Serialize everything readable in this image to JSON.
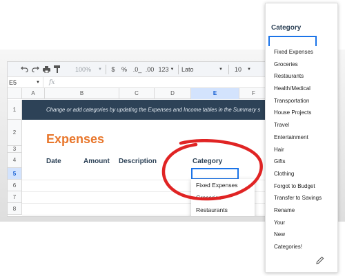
{
  "toolbar": {
    "zoom": "100%",
    "currency": "$",
    "percent": "%",
    "dec_less": ".0_",
    "dec_more": ".00",
    "number_format": "123",
    "font": "Lato",
    "font_size": "10"
  },
  "formula_bar": {
    "cell_ref": "E5",
    "fx": "fx"
  },
  "columns": [
    "A",
    "B",
    "C",
    "D",
    "E",
    "F"
  ],
  "rows": [
    "1",
    "2",
    "3",
    "4",
    "5",
    "6",
    "7",
    "8"
  ],
  "sheet": {
    "banner": "Change or add categories by updating the Expenses and Income tables in the Summary s",
    "title": "Expenses",
    "headers": {
      "date": "Date",
      "amount": "Amount",
      "description": "Description",
      "category": "Category"
    }
  },
  "mini_dropdown": [
    "Fixed Expenses",
    "Groceries",
    "Restaurants"
  ],
  "panel": {
    "title": "Category",
    "options": [
      "Fixed Expenses",
      "Groceries",
      "Restaurants",
      "Health/Medical",
      "Transportation",
      "House Projects",
      "Travel",
      "Entertainment",
      "Hair",
      "Gifts",
      "Clothing",
      "Forgot to Budget",
      "Transfer to Savings",
      "Rename",
      "Your",
      "New",
      "Categories!"
    ]
  },
  "colors": {
    "banner": "#2d4257",
    "title": "#e8762b",
    "headers": "#2d4257",
    "selection": "#1a73e8",
    "highlight_circle": "#e02424"
  }
}
